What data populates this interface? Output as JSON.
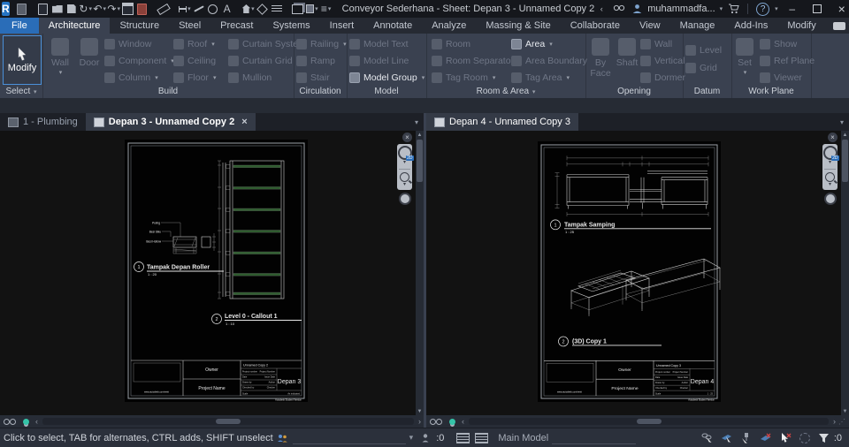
{
  "titlebar": {
    "logo": "R",
    "title": "Conveyor Sederhana - Sheet: Depan 3 - Unnamed Copy 2",
    "account": "muhammadfa...",
    "help": "?"
  },
  "glyphs": {
    "caret": "▾",
    "close": "×",
    "undo": "↶",
    "redo": "↷",
    "sync": "↻",
    "text_tool": "A",
    "menu": "≡",
    "chev_left": "‹",
    "chev_right": "›",
    "chev_up": "▴",
    "chev_down": "▾",
    "minimize": "–",
    "grip": "⋰"
  },
  "ribbon_tabs": {
    "file": "File",
    "tabs": [
      "Architecture",
      "Structure",
      "Steel",
      "Precast",
      "Systems",
      "Insert",
      "Annotate",
      "Analyze",
      "Massing & Site",
      "Collaborate",
      "View",
      "Manage",
      "Add-Ins",
      "Modify"
    ]
  },
  "ribbon": {
    "select": {
      "button": "Modify",
      "label": "Select"
    },
    "build": {
      "label": "Build",
      "items": {
        "wall": "Wall",
        "door": "Door",
        "window": "Window",
        "component": "Component",
        "column": "Column",
        "roof": "Roof",
        "ceiling": "Ceiling",
        "floor": "Floor",
        "curtain_system": "Curtain System",
        "curtain_grid": "Curtain Grid",
        "mullion": "Mullion"
      }
    },
    "circulation": {
      "label": "Circulation",
      "items": {
        "railing": "Railing",
        "ramp": "Ramp",
        "stair": "Stair"
      }
    },
    "model": {
      "label": "Model",
      "items": {
        "model_text": "Model Text",
        "model_line": "Model Line",
        "model_group": "Model Group"
      }
    },
    "room_area": {
      "label": "Room & Area",
      "items": {
        "room": "Room",
        "room_separator": "Room Separator",
        "tag_room": "Tag Room",
        "area": "Area",
        "area_boundary": "Area Boundary",
        "tag_area": "Tag Area"
      }
    },
    "opening": {
      "label": "Opening",
      "items": {
        "by_face": "By Face",
        "shaft": "Shaft",
        "wall": "Wall",
        "vertical": "Vertical",
        "dormer": "Dormer"
      }
    },
    "datum": {
      "label": "Datum",
      "items": {
        "level": "Level",
        "grid": "Grid"
      }
    },
    "work_plane": {
      "label": "Work Plane",
      "items": {
        "set": "Set",
        "show": "Show",
        "ref_plane": "Ref Plane",
        "viewer": "Viewer"
      }
    }
  },
  "left_pane": {
    "tab_inactive": "1 - Plumbing",
    "tab_active": "Depan 3 - Unnamed Copy 2",
    "sheet": {
      "view1": {
        "num": "1",
        "title": "Tampak Depan Roller",
        "scale": "1 : 20",
        "label_puling": "Puling",
        "label_besi_siku": "Besi Siku",
        "label_besi_hollow": "Besi Hollow"
      },
      "view2": {
        "num": "2",
        "title": "Level 0 - Callout 1",
        "scale": "1 : 10"
      },
      "titleblock": {
        "owner": "Owner",
        "project_name": "Project Name",
        "url": "www.autodesk.com/revit",
        "sheet_name": "Unnamed Copy 2",
        "sheet_number": "Depan 3",
        "project_number_label": "Project number",
        "project_number": "Project Number",
        "date_label": "Date",
        "date": "Issue Date",
        "drawn_label": "Drawn by",
        "drawn": "Author",
        "checked_label": "Checked by",
        "checked": "Checker",
        "scale_label": "Scale",
        "scale": "As indicated"
      },
      "watermark": "Autodesk Student Version"
    }
  },
  "right_pane": {
    "tab_active": "Depan 4 - Unnamed Copy 3",
    "sheet": {
      "view1": {
        "num": "1",
        "title": "Tampak Samping",
        "scale": "1 : 25"
      },
      "view2": {
        "num": "2",
        "title": "(3D) Copy 1"
      },
      "titleblock": {
        "owner": "Owner",
        "project_name": "Project Name",
        "url": "www.autodesk.com/revit",
        "sheet_name": "Unnamed Copy 3",
        "sheet_number": "Depan 4",
        "project_number_label": "Project number",
        "project_number": "Project Number",
        "date_label": "Date",
        "date": "Issue Date",
        "drawn_label": "Drawn by",
        "drawn": "Author",
        "checked_label": "Checked by",
        "checked": "Checker",
        "scale_label": "Scale",
        "scale": "1 : 25"
      },
      "watermark": "Autodesk Student Version"
    }
  },
  "statusbar": {
    "prompt": "Click to select, TAB for alternates, CTRL adds, SHIFT unselect",
    "requests_count": ":0",
    "design_option": "Main Model",
    "filter_count": ":0"
  }
}
